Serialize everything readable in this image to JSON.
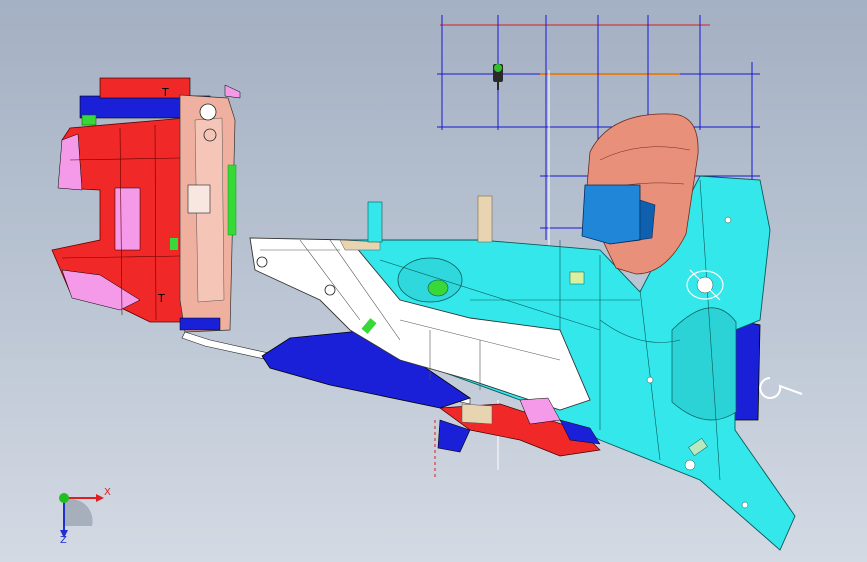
{
  "viewer": {
    "background_top": "#a4b0c3",
    "background_bottom": "#d4dae4"
  },
  "model": {
    "panel_colors": {
      "cyan": "#33e7ea",
      "red": "#f02828",
      "salmon": "#f0b0a0",
      "blue": "#1a20d8",
      "white": "#ffffff",
      "tan": "#e8d4b0",
      "green": "#39d839",
      "pink": "#f49ae8"
    },
    "part_labels": [
      "T",
      "T",
      "T",
      "T"
    ]
  },
  "compass": {
    "icon": "axis-triad-icon",
    "x_label": "X",
    "z_label": "Z",
    "x_color": "#e02020",
    "y_color": "#20c020",
    "z_color": "#2030d0"
  }
}
